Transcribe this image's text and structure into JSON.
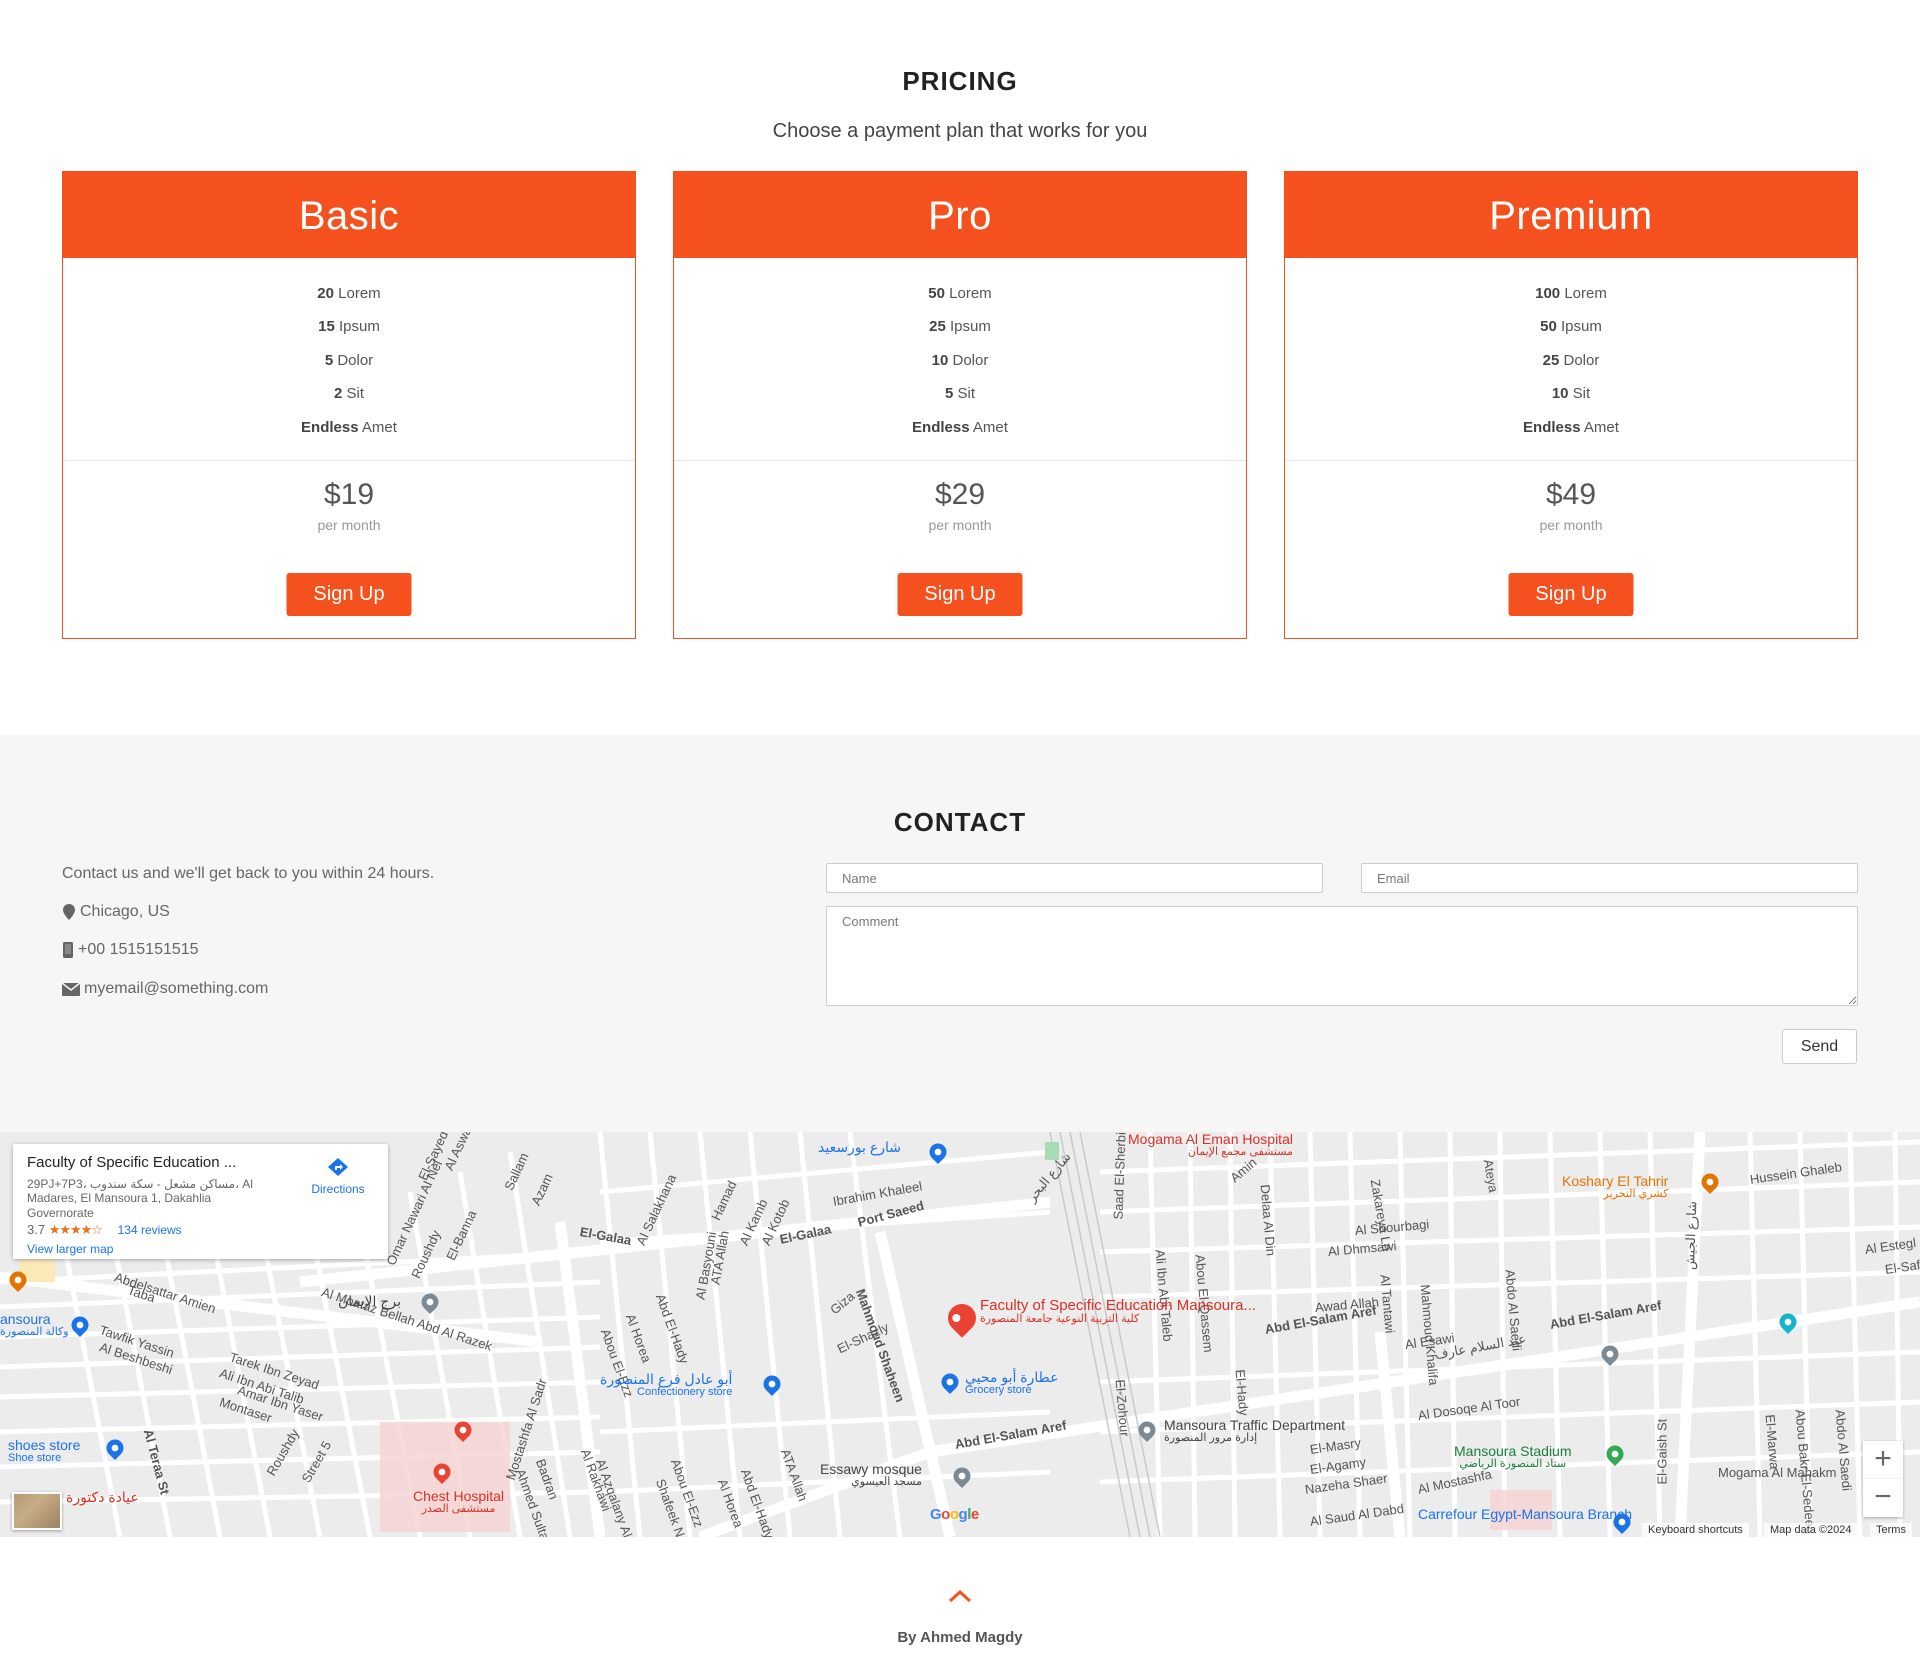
{
  "pricing": {
    "title": "PRICING",
    "subtitle": "Choose a payment plan that works for you",
    "accent": "#f4511e",
    "plans": [
      {
        "name": "Basic",
        "features": [
          {
            "qty": "20",
            "item": "Lorem"
          },
          {
            "qty": "15",
            "item": "Ipsum"
          },
          {
            "qty": "5",
            "item": "Dolor"
          },
          {
            "qty": "2",
            "item": "Sit"
          },
          {
            "qty": "Endless",
            "item": "Amet"
          }
        ],
        "price": "$19",
        "period": "per month",
        "button": "Sign Up"
      },
      {
        "name": "Pro",
        "features": [
          {
            "qty": "50",
            "item": "Lorem"
          },
          {
            "qty": "25",
            "item": "Ipsum"
          },
          {
            "qty": "10",
            "item": "Dolor"
          },
          {
            "qty": "5",
            "item": "Sit"
          },
          {
            "qty": "Endless",
            "item": "Amet"
          }
        ],
        "price": "$29",
        "period": "per month",
        "button": "Sign Up"
      },
      {
        "name": "Premium",
        "features": [
          {
            "qty": "100",
            "item": "Lorem"
          },
          {
            "qty": "50",
            "item": "Ipsum"
          },
          {
            "qty": "25",
            "item": "Dolor"
          },
          {
            "qty": "10",
            "item": "Sit"
          },
          {
            "qty": "Endless",
            "item": "Amet"
          }
        ],
        "price": "$49",
        "period": "per month",
        "button": "Sign Up"
      }
    ]
  },
  "contact": {
    "title": "CONTACT",
    "intro": "Contact us and we'll get back to you within 24 hours.",
    "location": "Chicago, US",
    "phone": "+00 1515151515",
    "email": "myemail@something.com",
    "form": {
      "name_placeholder": "Name",
      "email_placeholder": "Email",
      "comment_placeholder": "Comment",
      "send_label": "Send"
    }
  },
  "map": {
    "info": {
      "title": "Faculty of Specific Education ...",
      "address": "29PJ+7P3، مساكن مشعل - سكة سندوب، Al Madares, El Mansoura 1, Dakahlia Governorate",
      "rating": "3.7",
      "stars": "★★★★☆",
      "reviews": "134 reviews",
      "larger": "View larger map",
      "directions": "Directions"
    },
    "zoom_in": "+",
    "zoom_out": "−",
    "google": "Google",
    "footer_links": {
      "shortcuts": "Keyboard shortcuts",
      "data": "Map data ©2024",
      "terms": "Terms"
    },
    "main_place": {
      "name": "Faculty of Specific Education Mansoura...",
      "arabic": "كلية التربية النوعية جامعة المنصورة"
    },
    "pois": [
      {
        "name": "Mogama Al Eman Hospital",
        "arabic": "مستشفى مجمع الإيمان"
      },
      {
        "name": "Koshary El Tahrir",
        "arabic": "كشري التحرير"
      },
      {
        "name": "Mansoura Traffic Department",
        "arabic": "إدارة مرور المنصورة"
      },
      {
        "name": "Mansoura Stadium",
        "arabic": "ستاد المنصورة الرياضي"
      },
      {
        "name": "Carrefour Egypt-Mansoura Branch"
      },
      {
        "name": "Chest Hospital",
        "arabic": "مستشفى الصدر"
      },
      {
        "name": "Essawy mosque",
        "arabic": "مسجد العيسوي"
      },
      {
        "name": "عطارة أبو محيي",
        "sub": "Grocery store"
      },
      {
        "name": "أبو عادل فرع المنصورة",
        "sub": "Confectionery store"
      },
      {
        "name": "shoes store",
        "sub": "Shoe store"
      },
      {
        "name": "ansoura",
        "arabic": "وكالة المنصورة"
      },
      {
        "name": "برج الإيمان"
      },
      {
        "name": "شارع بورسعيد"
      },
      {
        "name": "عيادة دكتورة"
      }
    ],
    "streets": [
      "Abd El-Salam Aref",
      "Abd El-Salam Aref",
      "Abd El-Salam Aref",
      "El-Galaa",
      "El-Galaa",
      "Port Saeed",
      "Mahmoud Shaheen",
      "Al Moataz Bellah Abd Al Razek",
      "Hussein Ghaleb",
      "Ibrahim Khaleel",
      "Al Shourbagi",
      "Al Dhmsawi",
      "Awad Allah",
      "Al Esawi",
      "Al Dosoqe Al Toor",
      "El-Masry",
      "El-Agamy",
      "Nazeha Shaer",
      "Al Mostashfa",
      "Al Saud Al Dabd",
      "Mogama Al Mahakm",
      "El-Gaish St",
      "Al Teraa St",
      "Tawfik Yassin",
      "Al Beshbeshi",
      "Tarek Ibn Zeyad",
      "Ali Ibn Abi Talib",
      "Amar Ibn Yaser",
      "Montaser",
      "Mostashfa Al Sadr",
      "Al Rakhawi",
      "Badran",
      "Ahmed Sultan",
      "Abd El-Hady",
      "Al Horea",
      "ATA Allah",
      "El-Shazly",
      "Giza",
      "Saad El-Sherbiny",
      "Ali Ibn Abi Taleb",
      "El-Zohour",
      "Abou El-Qassem",
      "Amin",
      "Delaa Al Din",
      "Zakareya Ln",
      "Ateya",
      "Al Tantawi",
      "Mahmoud Khalifa",
      "Abdo Al Saedi",
      "Al Estegl",
      "El-Safa",
      "Abou Bakr El-Sedeeq",
      "El-Marwa",
      "Abdo Al Saedi",
      "El-Hady",
      "Roushdy",
      "Street 5",
      "Al Aswaq",
      "El-Sayed",
      "Sallam",
      "Azam",
      "Al Salakhana",
      "Hamad",
      "Al Kamb",
      "Al Kotob",
      "Abd El-Hady",
      "Al Basyouni",
      "ATA Allah",
      "Abou El-Ezz",
      "Al Horea",
      "Abou El-Ezz",
      "Al Azqalany Al Gedeed",
      "Shafeek Nasif",
      "Abdelsattar Amien",
      "Taba",
      "Omar Nawari Al Nel",
      "Roushdy",
      "El-Banna",
      "عبد السلام عارف",
      "شارع الجيش",
      "شارع البحر"
    ]
  },
  "footer": {
    "credit": "By Ahmed Magdy"
  }
}
